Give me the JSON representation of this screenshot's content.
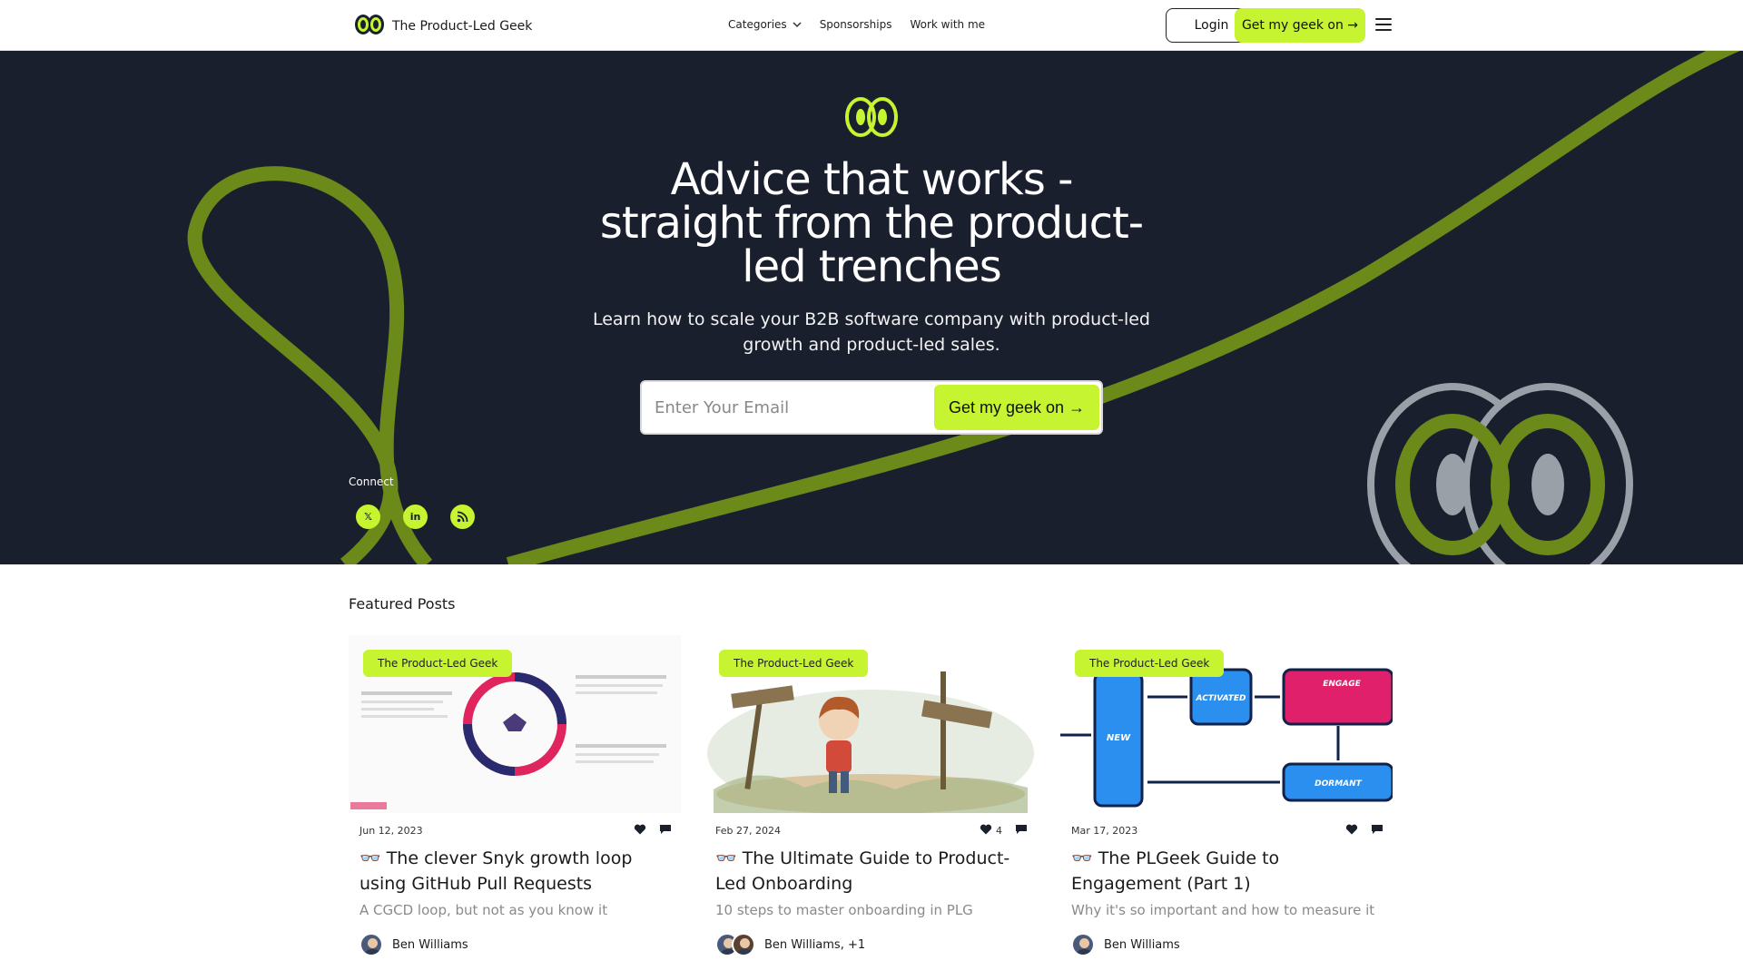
{
  "header": {
    "brand": "The Product-Led Geek",
    "nav": [
      "Categories",
      "Sponsorships",
      "Work with me"
    ],
    "login": "Login",
    "cta": "Get my geek on →"
  },
  "hero": {
    "title": "Advice that works - straight from the product-led trenches",
    "subtitle": "Learn how to scale your B2B software company with product-led growth and product-led sales.",
    "email_placeholder": "Enter Your Email",
    "signup_button": "Get my geek on →",
    "connect_label": "Connect",
    "social": [
      {
        "icon": "x-icon",
        "glyph": "𝕏"
      },
      {
        "icon": "linkedin-icon",
        "glyph": "in"
      },
      {
        "icon": "rss-icon",
        "glyph": "◉"
      }
    ]
  },
  "featured": {
    "title": "Featured Posts",
    "posts": [
      {
        "tag": "The Product-Led Geek",
        "date": "Jun 12, 2023",
        "likes": "",
        "title": "👓 The clever Snyk growth loop using GitHub Pull Requests",
        "subtitle": "A CGCD loop, but not as you know it",
        "author": "Ben Williams"
      },
      {
        "tag": "The Product-Led Geek",
        "date": "Feb 27, 2024",
        "likes": "4",
        "title": "👓 The Ultimate Guide to Product-Led Onboarding",
        "subtitle": "10 steps to master onboarding in PLG",
        "author": "Ben Williams, +1"
      },
      {
        "tag": "The Product-Led Geek",
        "date": "Mar 17, 2023",
        "likes": "",
        "title": "👓 The PLGeek Guide to Engagement (Part 1)",
        "subtitle": "Why it's so important and how to measure it",
        "author": "Ben Williams"
      }
    ]
  },
  "colors": {
    "accent": "#c6f431",
    "hero_bg": "#1a1f2e",
    "swirl": "#6b8a1a"
  }
}
